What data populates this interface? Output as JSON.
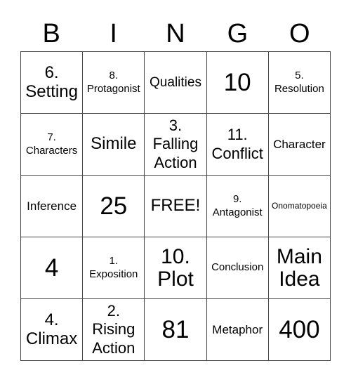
{
  "header": {
    "letters": [
      "B",
      "I",
      "N",
      "G",
      "O"
    ]
  },
  "cells": [
    "6.\nSetting",
    "8.\nProtagonist",
    "Qualities",
    "10",
    "5.\nResolution",
    "7.\nCharacters",
    "Simile",
    "3.\nFalling\nAction",
    "11.\nConflict",
    "Character",
    "Inference",
    "25",
    "FREE!",
    "9.\nAntagonist",
    "Onomatopoeia",
    "4",
    "1.\nExposition",
    "10.\nPlot",
    "Conclusion",
    "Main\nIdea",
    "4.\nClimax",
    "2.\nRising\nAction",
    "81",
    "Metaphor",
    "400"
  ]
}
